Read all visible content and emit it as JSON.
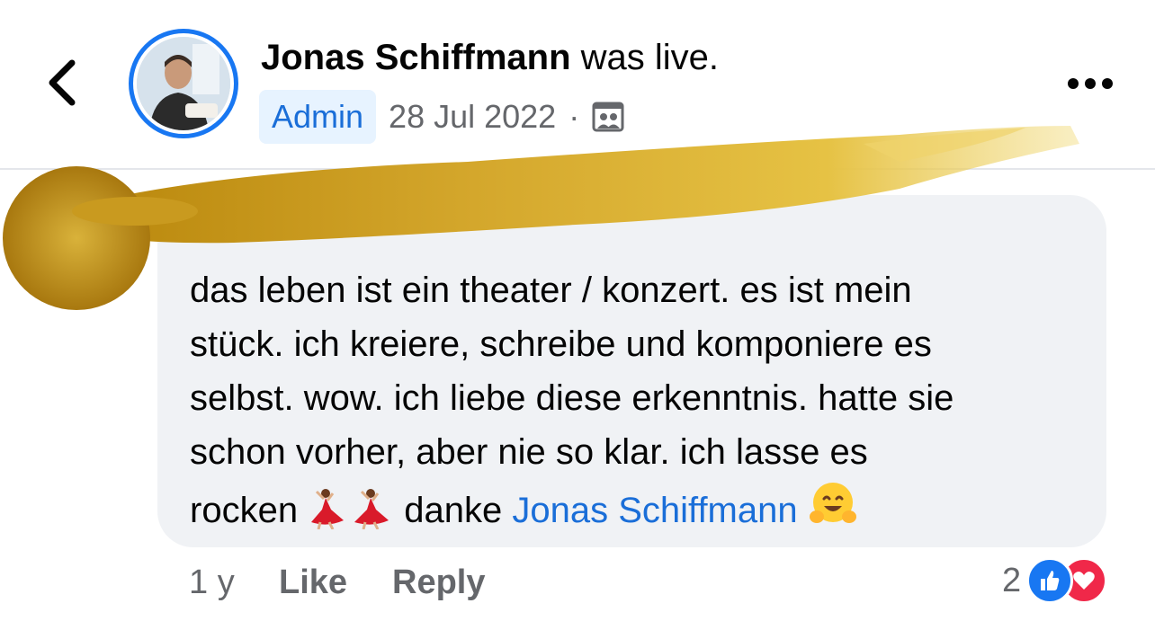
{
  "header": {
    "author_name": "Jonas Schiffmann",
    "status_text": " was live.",
    "role_badge": "Admin",
    "date": "28 Jul 2022",
    "separator": "·",
    "privacy_icon": "group-privacy-icon",
    "back_icon": "chevron-left-icon",
    "more_icon": "more-horizontal-icon"
  },
  "comment": {
    "text_lines": [
      "das leben ist ein theater / konzert. es ist mein",
      "stück. ich kreiere, schreibe und komponiere es",
      "selbst. wow. ich liebe diese erkenntnis. hatte sie",
      "schon vorher, aber nie so klar. ich lasse es"
    ],
    "last_line_start": "rocken ",
    "last_line_middle": " danke ",
    "mention": "Jonas Schiffmann",
    "emojis": [
      "dancer-emoji",
      "dancer-emoji",
      "hugging-face-emoji"
    ]
  },
  "footer": {
    "time": "1 y",
    "like_label": "Like",
    "reply_label": "Reply",
    "reaction_count": "2",
    "reaction_icons": [
      "like-reaction-icon",
      "love-reaction-icon"
    ]
  },
  "colors": {
    "accent": "#1877f2",
    "mention": "#1a6ed8",
    "bubble": "#f0f2f5",
    "muted": "#65676b",
    "gold_overlay": "#c9a227"
  }
}
